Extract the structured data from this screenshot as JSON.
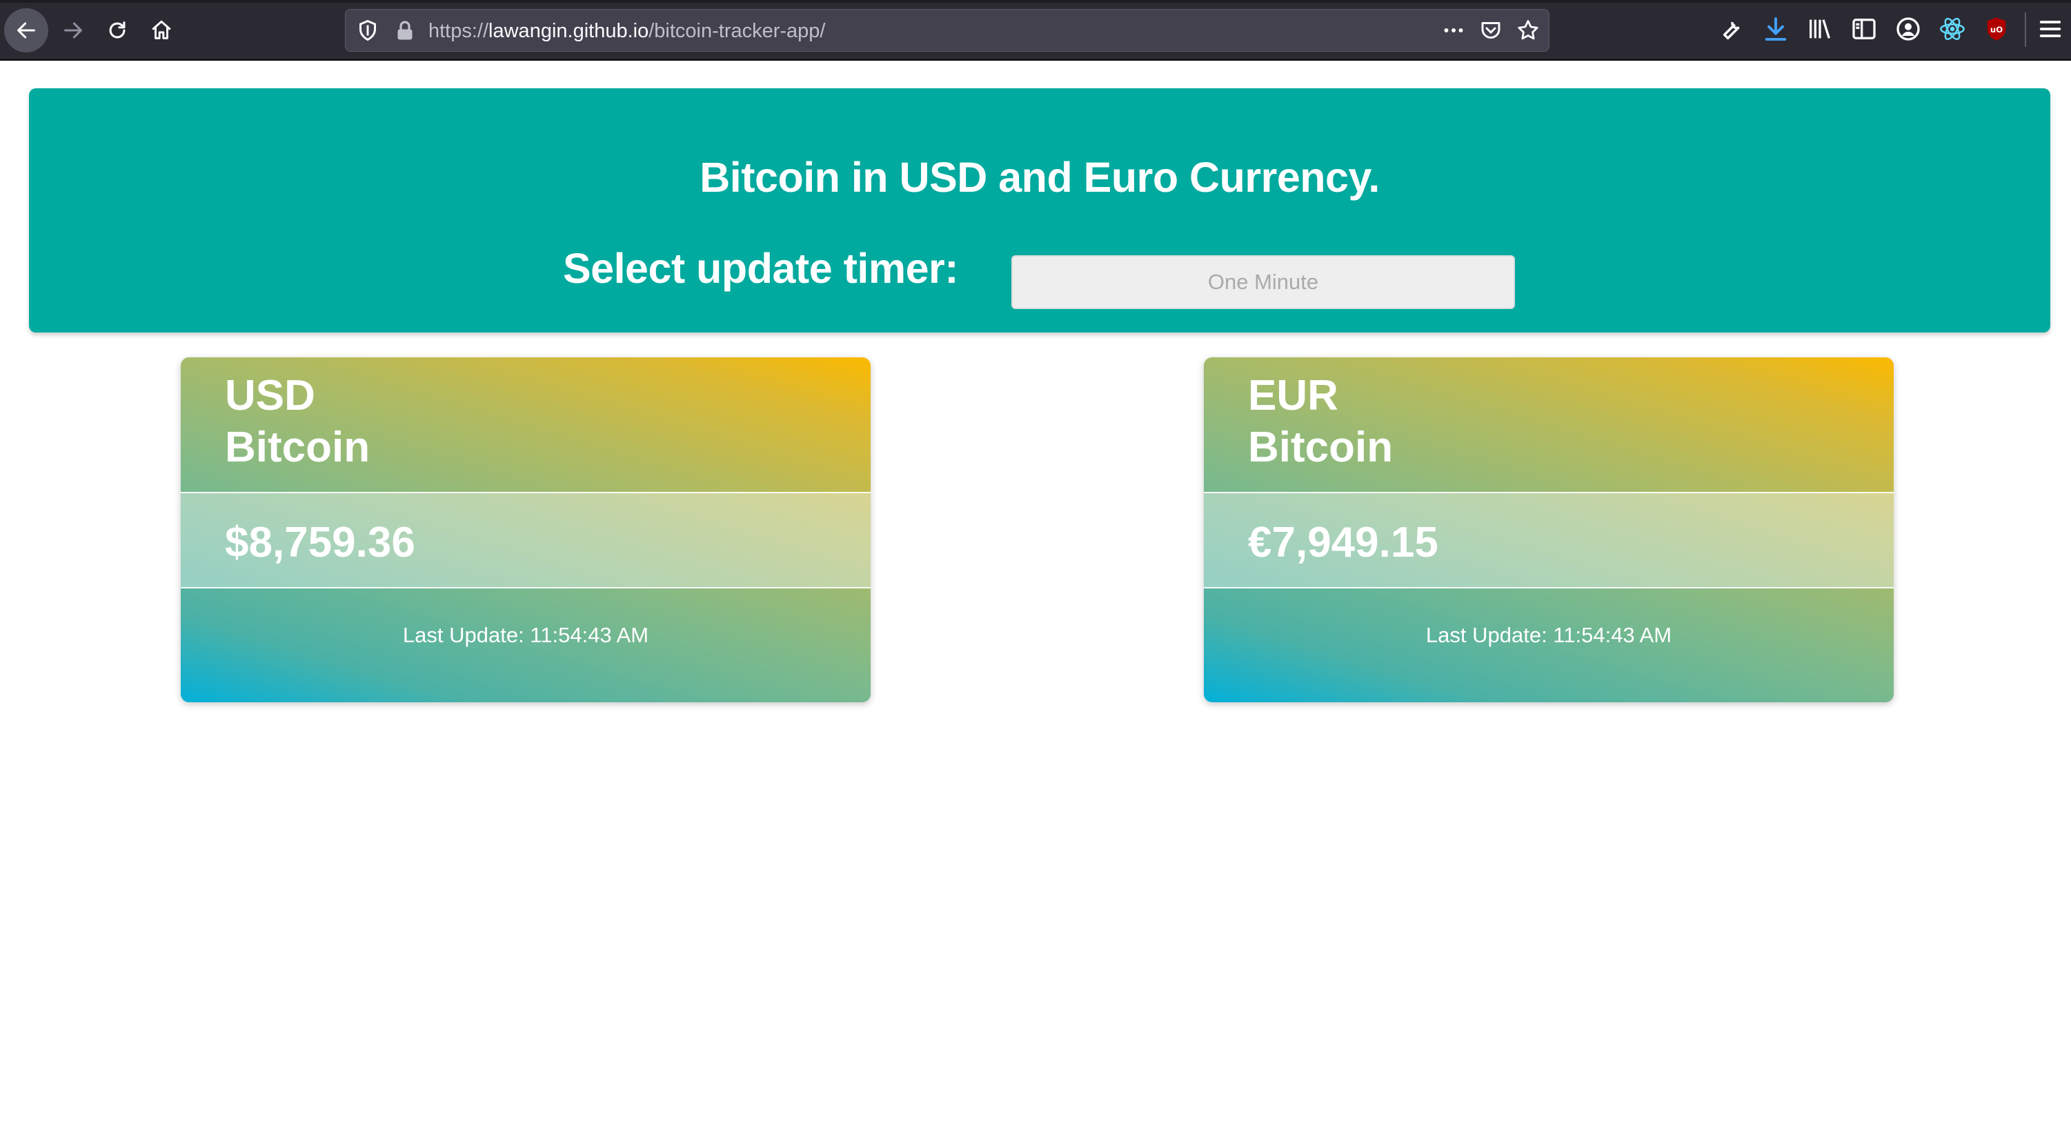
{
  "browser": {
    "url_scheme": "https://",
    "url_host": "lawangin.github.io",
    "url_path": "/bitcoin-tracker-app/",
    "icons": [
      "back-arrow-icon",
      "forward-arrow-icon",
      "reload-icon",
      "home-icon",
      "shield-icon",
      "lock-icon",
      "more-icon",
      "pocket-icon",
      "bookmark-star-icon",
      "wrench-icon",
      "download-icon",
      "library-icon",
      "sidebar-icon",
      "account-icon",
      "react-devtools-icon",
      "ublock-icon",
      "menu-icon"
    ]
  },
  "header": {
    "title": "Bitcoin in USD and Euro Currency.",
    "timer_label": "Select update timer:",
    "timer_value": "One Minute"
  },
  "cards": [
    {
      "currency": "USD",
      "subtitle": "Bitcoin",
      "price": "$8,759.36",
      "last_update": "Last Update: 11:54:43 AM"
    },
    {
      "currency": "EUR",
      "subtitle": "Bitcoin",
      "price": "€7,949.15",
      "last_update": "Last Update: 11:54:43 AM"
    }
  ],
  "colors": {
    "header_bg": "#00aa9e",
    "browser_bg": "#2b2a33",
    "gradient_start": "#04b0d9",
    "gradient_end": "#fbb900"
  }
}
